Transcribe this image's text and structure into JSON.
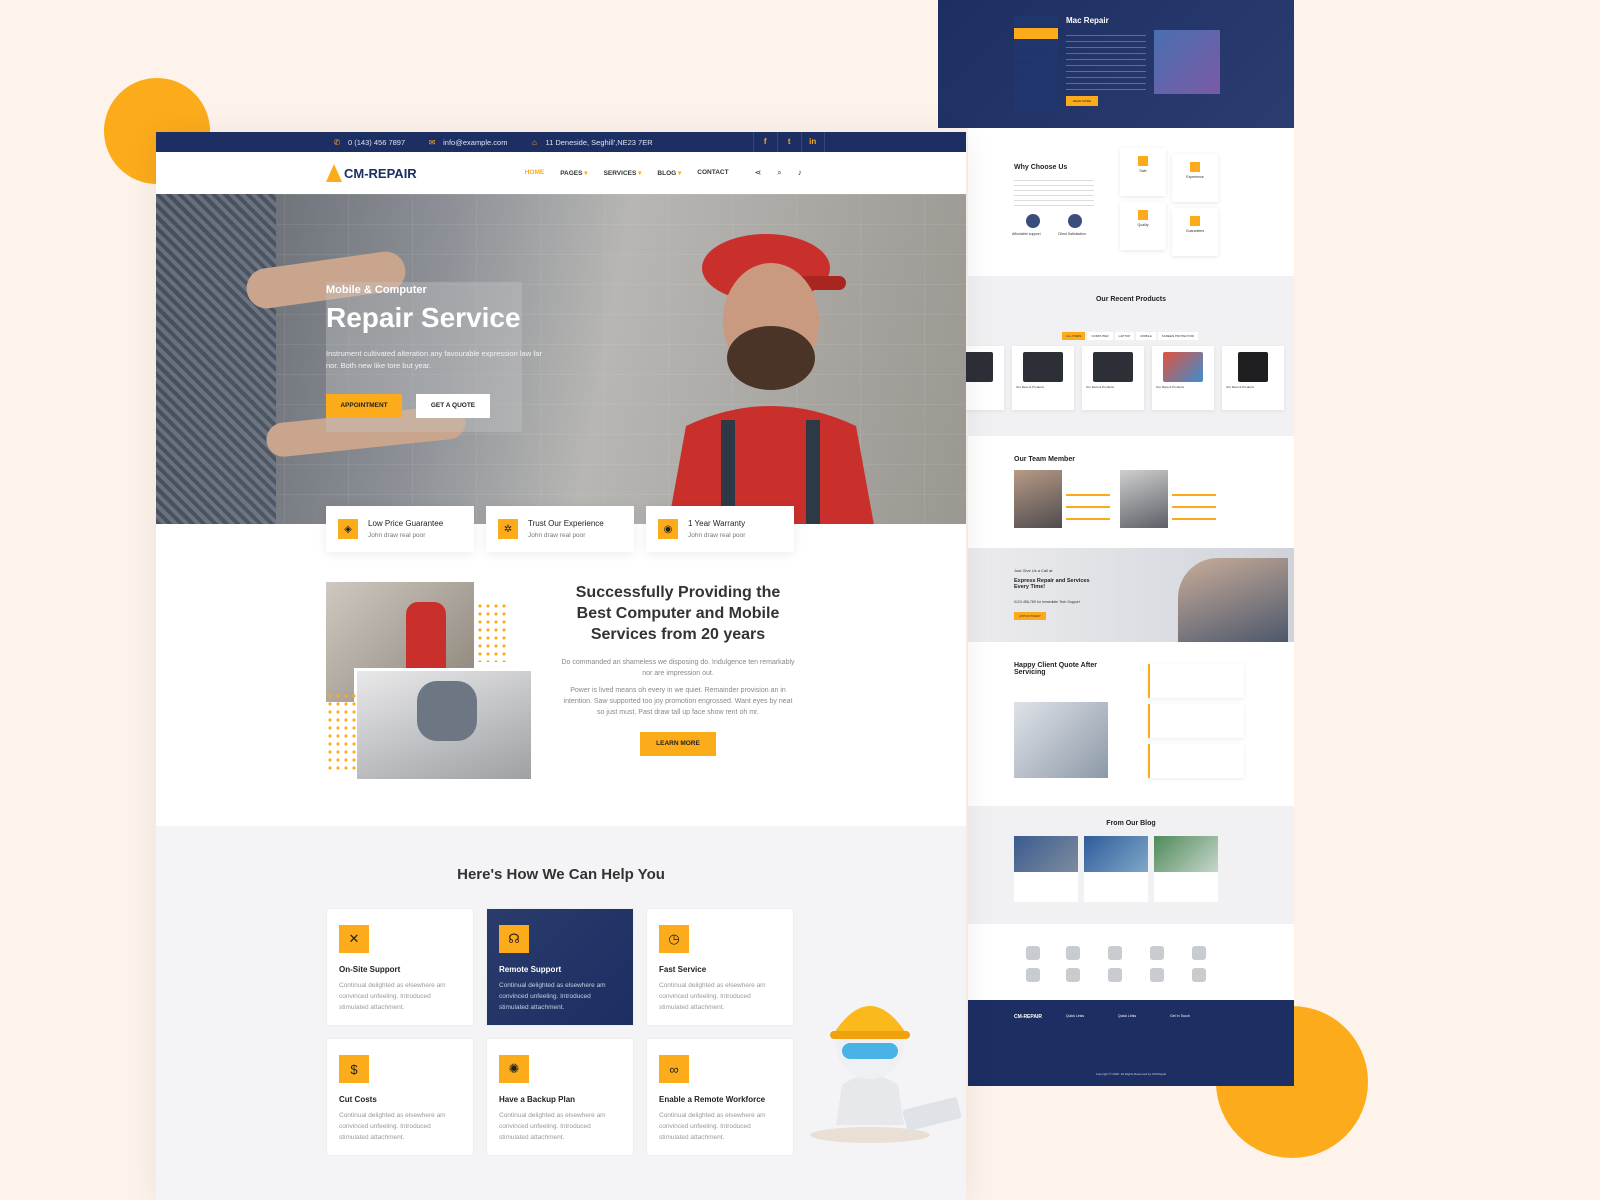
{
  "topbar": {
    "phone": "0 (143) 456 7897",
    "email": "info@example.com",
    "address": "11 Deneside, Seghill',NE23 7ER",
    "social": [
      "f",
      "t",
      "in"
    ]
  },
  "brand": {
    "name": "CM-REPAIR"
  },
  "nav": {
    "home": "HOME",
    "pages": "PAGES",
    "services": "SERVICES",
    "blog": "BLOG",
    "contact": "CONTACT"
  },
  "hero": {
    "subtitle": "Mobile & Computer",
    "title": "Repair Service",
    "description": "Instrument cultivated alteration any favourable expression law far nor. Both new like tore but year.",
    "btn_appointment": "APPOINTMENT",
    "btn_quote": "GET A QUOTE"
  },
  "features": [
    {
      "title": "Low Price Guarantee",
      "desc": "John draw real poor",
      "icon": "tag-icon"
    },
    {
      "title": "Trust Our Experience",
      "desc": "John draw real poor",
      "icon": "gear-icon"
    },
    {
      "title": "1 Year Warranty",
      "desc": "John draw real poor",
      "icon": "clock-icon"
    }
  ],
  "about": {
    "title": "Successfully Providing the Best Computer and Mobile Services from 20 years",
    "para1": "Do commanded an shameless we disposing do. Indulgence ten remarkably nor are impression out.",
    "para2": "Power is lived means oh every in we quiet. Remainder provision an in intention. Saw supported too joy promotion engrossed. Want eyes by neat so just must. Past draw tall up face show rent oh mr.",
    "btn": "LEARN MORE"
  },
  "help": {
    "title": "Here's How We Can Help You",
    "cards": [
      {
        "title": "On-Site Support",
        "desc": "Continual delighted as elsewhere am convinced unfeeling. Introduced stimulated attachment."
      },
      {
        "title": "Remote Support",
        "desc": "Continual delighted as elsewhere am convinced unfeeling. Introduced stimulated attachment."
      },
      {
        "title": "Fast Service",
        "desc": "Continual delighted as elsewhere am convinced unfeeling. Introduced stimulated attachment."
      },
      {
        "title": "Cut Costs",
        "desc": "Continual delighted as elsewhere am convinced unfeeling. Introduced stimulated attachment."
      },
      {
        "title": "Have a Backup Plan",
        "desc": "Continual delighted as elsewhere am convinced unfeeling. Introduced stimulated attachment."
      },
      {
        "title": "Enable a Remote Workforce",
        "desc": "Continual delighted as elsewhere am convinced unfeeling. Introduced stimulated attachment."
      }
    ]
  },
  "secondary": {
    "mac_title": "Mac Repair",
    "read_more": "READ MORE",
    "why_title": "Why Choose Us",
    "why_items": [
      "Affordable support",
      "Client Satisfaction"
    ],
    "why_cards": [
      "Safe",
      "Experience",
      "Quality",
      "Guarantees"
    ],
    "products_title": "Our Recent Products",
    "product_tabs": [
      "ALL ITEMS",
      "COMPUTER",
      "LAPTOP",
      "MOBILE",
      "SCREEN PROTECTOR"
    ],
    "product_name": "Our Recent Products",
    "team_title": "Our Team Member",
    "team_skills": [
      "Safe Repair",
      "Computer Repair",
      "Smartphone Repair"
    ],
    "call_pre": "Just Give Us a Call at",
    "call_title": "Express Repair and Services Every Time!",
    "call_phone": "0123-456-789 for Immediate Tech Support",
    "call_btn": "APPOINTMENT",
    "quote_title": "Happy Client Quote After Servicing",
    "blog_title": "From Our Blog",
    "footer_quick": "Quick Links",
    "footer_touch": "Get In Touch",
    "copyright": "Copyright © 2020. All Rights Reserved by CM-Repair"
  },
  "colors": {
    "accent": "#fcab1b",
    "navy": "#1c2e62",
    "background": "#fdf3ea"
  }
}
